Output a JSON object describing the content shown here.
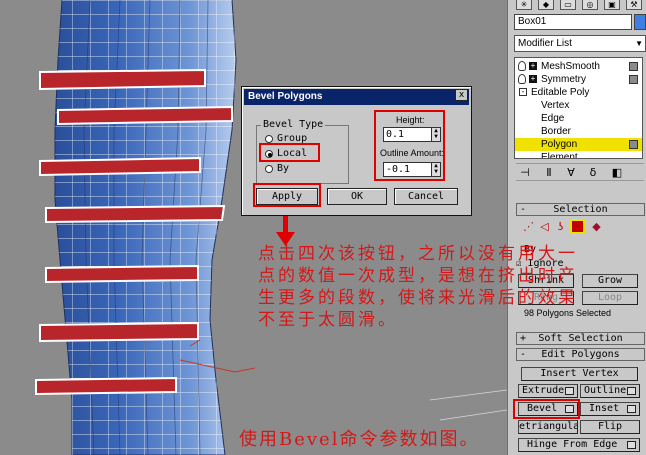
{
  "viewport": {
    "icons": [
      "arrow-down-icon"
    ]
  },
  "panel": {
    "object_name": "Box01",
    "object_color": "#3f7fe0",
    "modifier_list_label": "Modifier List",
    "stack": [
      {
        "label": "MeshSmooth",
        "kind": "modifier"
      },
      {
        "label": "Symmetry",
        "kind": "modifier"
      },
      {
        "label": "Editable Poly",
        "kind": "base"
      },
      {
        "label": "Vertex",
        "kind": "sub"
      },
      {
        "label": "Edge",
        "kind": "sub"
      },
      {
        "label": "Border",
        "kind": "sub"
      },
      {
        "label": "Polygon",
        "kind": "sub",
        "selected": true
      },
      {
        "label": "Element",
        "kind": "sub"
      }
    ],
    "selection_rollout": "Selection",
    "by_label": "By",
    "ignore_label": "Ignore",
    "shrink_label": "Shrink",
    "grow_label": "Grow",
    "ring_label": "Ring",
    "loop_label": "Loop",
    "selected_count": "98 Polygons Selected",
    "soft_selection_rollout": "Soft Selection",
    "edit_polygons_rollout": "Edit Polygons",
    "insert_vertex_label": "Insert Vertex",
    "extrude_label": "Extrude",
    "outline_label": "Outline",
    "bevel_label": "Bevel",
    "inset_label": "Inset",
    "retriangulate_label": "etriangula",
    "flip_label": "Flip",
    "hinge_label": "Hinge From Edge",
    "rollout_minus": "-",
    "rollout_plus": "+"
  },
  "dialog": {
    "title": "Bevel Polygons",
    "close_label": "x",
    "bevel_type_label": "Bevel Type",
    "options": [
      {
        "label": "Group",
        "checked": false
      },
      {
        "label": "Local",
        "checked": true
      },
      {
        "label": "By",
        "checked": false
      }
    ],
    "height_label": "Height:",
    "height_value": "0.1",
    "outline_label": "Outline Amount:",
    "outline_value": "-0.1",
    "apply_label": "Apply",
    "ok_label": "OK",
    "cancel_label": "Cancel"
  },
  "annotation": {
    "note": "点击四次该按钮，之所以没有用大一点的数值一次成型，是想在挤出时产生更多的段数，使将来光滑后的效果不至于太圆滑。",
    "caption": "使用Bevel命令参数如图。"
  },
  "colors": {
    "highlight": "#e00000",
    "annotation_text": "#d41818",
    "mesh_blue": "#2e56a8",
    "selected_polygon": "#b8262c",
    "stack_selected": "#f0e100"
  }
}
